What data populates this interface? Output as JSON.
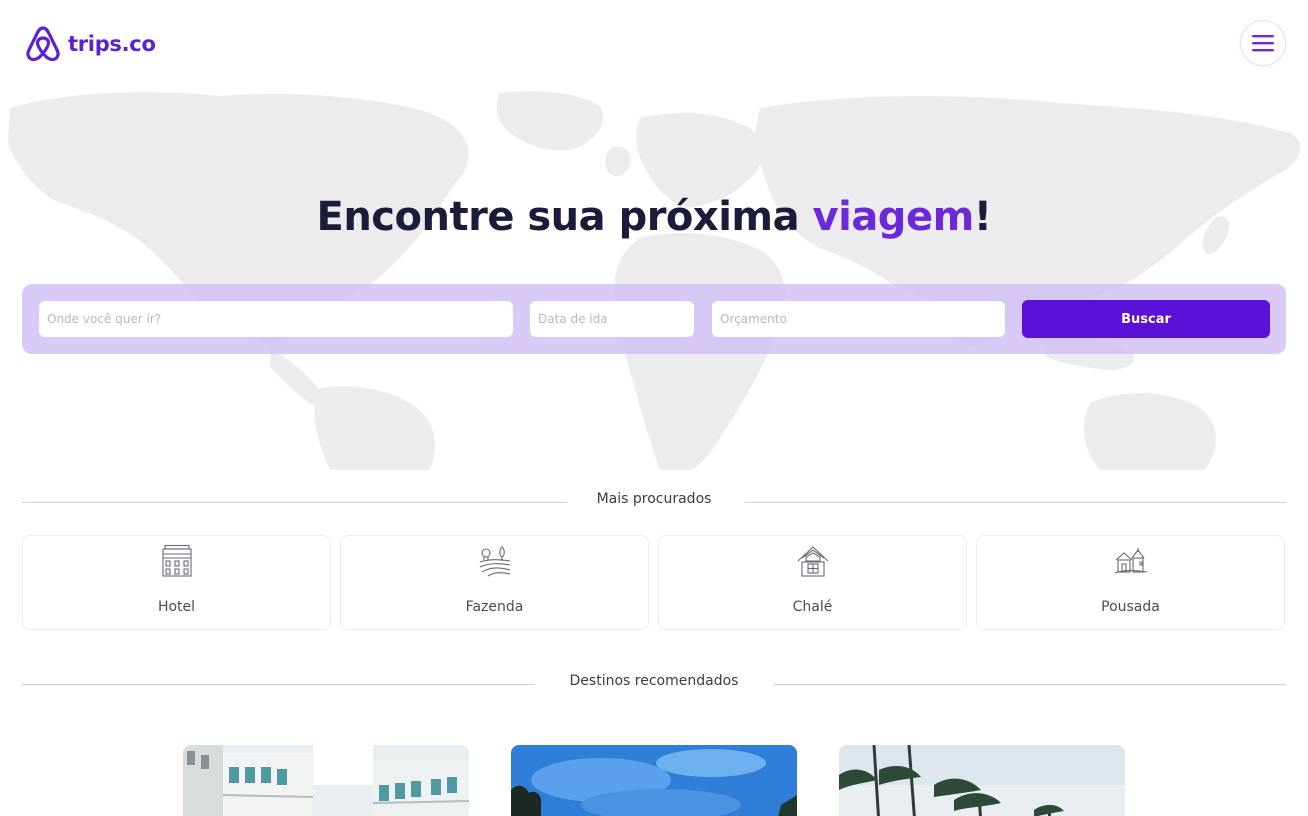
{
  "header": {
    "brand": "trips.co",
    "brand_color": "#5b21d6",
    "logo_icon": "airbnb-style-loop-icon",
    "menu_icon": "hamburger-menu-icon"
  },
  "hero": {
    "title_prefix": "Encontre sua próxima ",
    "title_accent": "viagem",
    "title_suffix": "!",
    "accent_color": "#6d28d9",
    "background": "world-map-illustration"
  },
  "search": {
    "destination_placeholder": "Onde você quer ir?",
    "date_placeholder": "Data de ida",
    "budget_placeholder": "Orçamento",
    "button_label": "Buscar",
    "button_color": "#5b10d8"
  },
  "most_searched": {
    "title": "Mais procurados",
    "items": [
      {
        "label": "Hotel",
        "icon": "hotel-icon"
      },
      {
        "label": "Fazenda",
        "icon": "farm-icon"
      },
      {
        "label": "Chalé",
        "icon": "chalet-icon"
      },
      {
        "label": "Pousada",
        "icon": "inn-icon"
      }
    ]
  },
  "recommended": {
    "title": "Destinos recomendados",
    "items": [
      {
        "image": "hotel-building-photo"
      },
      {
        "image": "tropical-sky-photo"
      },
      {
        "image": "palm-trees-beach-photo"
      }
    ]
  }
}
